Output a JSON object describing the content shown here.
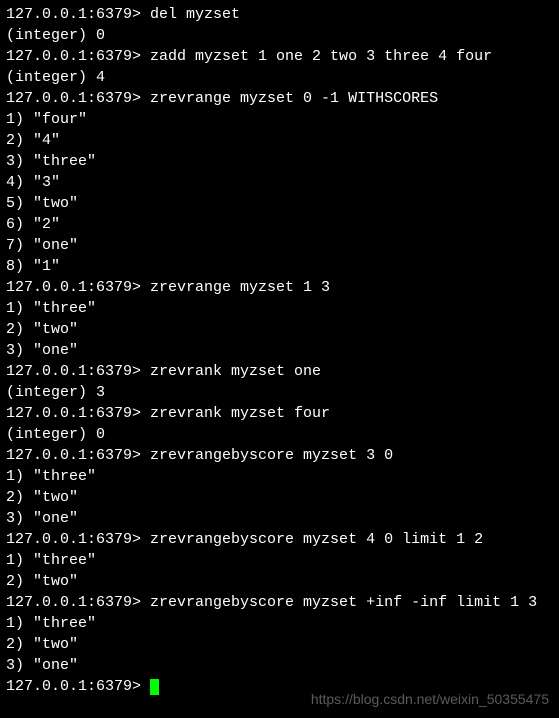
{
  "prompt": "127.0.0.1:6379> ",
  "lines": [
    {
      "type": "cmd",
      "text": "del myzset"
    },
    {
      "type": "out",
      "text": "(integer) 0"
    },
    {
      "type": "cmd",
      "text": "zadd myzset 1 one 2 two 3 three 4 four"
    },
    {
      "type": "out",
      "text": "(integer) 4"
    },
    {
      "type": "cmd",
      "text": "zrevrange myzset 0 -1 WITHSCORES"
    },
    {
      "type": "out",
      "text": "1) \"four\""
    },
    {
      "type": "out",
      "text": "2) \"4\""
    },
    {
      "type": "out",
      "text": "3) \"three\""
    },
    {
      "type": "out",
      "text": "4) \"3\""
    },
    {
      "type": "out",
      "text": "5) \"two\""
    },
    {
      "type": "out",
      "text": "6) \"2\""
    },
    {
      "type": "out",
      "text": "7) \"one\""
    },
    {
      "type": "out",
      "text": "8) \"1\""
    },
    {
      "type": "cmd",
      "text": "zrevrange myzset 1 3"
    },
    {
      "type": "out",
      "text": "1) \"three\""
    },
    {
      "type": "out",
      "text": "2) \"two\""
    },
    {
      "type": "out",
      "text": "3) \"one\""
    },
    {
      "type": "cmd",
      "text": "zrevrank myzset one"
    },
    {
      "type": "out",
      "text": "(integer) 3"
    },
    {
      "type": "cmd",
      "text": "zrevrank myzset four"
    },
    {
      "type": "out",
      "text": "(integer) 0"
    },
    {
      "type": "cmd",
      "text": "zrevrangebyscore myzset 3 0"
    },
    {
      "type": "out",
      "text": "1) \"three\""
    },
    {
      "type": "out",
      "text": "2) \"two\""
    },
    {
      "type": "out",
      "text": "3) \"one\""
    },
    {
      "type": "cmd",
      "text": "zrevrangebyscore myzset 4 0 limit 1 2"
    },
    {
      "type": "out",
      "text": "1) \"three\""
    },
    {
      "type": "out",
      "text": "2) \"two\""
    },
    {
      "type": "cmd",
      "text": "zrevrangebyscore myzset +inf -inf limit 1 3"
    },
    {
      "type": "out",
      "text": "1) \"three\""
    },
    {
      "type": "out",
      "text": "2) \"two\""
    },
    {
      "type": "out",
      "text": "3) \"one\""
    }
  ],
  "watermark": "https://blog.csdn.net/weixin_50355475"
}
